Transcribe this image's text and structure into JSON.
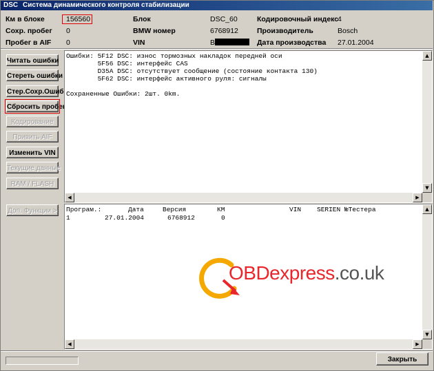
{
  "window": {
    "app": "DSC",
    "title": "Система динамического контроля стабилизации"
  },
  "info": {
    "km_label": "Км в блоке",
    "km_value": "156560",
    "sohr_label": "Сохр. пробег",
    "sohr_value": "0",
    "aif_label": "Пробег в AIF",
    "aif_value": "0",
    "block_label": "Блок",
    "block_value": "DSC_60",
    "bmw_label": "BMW номер",
    "bmw_value": "6768912",
    "vin_label": "VIN",
    "vin_value": "B",
    "code_label": "Кодировочный индекс",
    "code_value": "4",
    "maker_label": "Производитель",
    "maker_value": "Bosch",
    "date_label": "Дата производства",
    "date_value": "27.01.2004"
  },
  "buttons": {
    "read_errors": "Читать ошибки",
    "clear_errors": "Стереть ошибки",
    "clear_saved": "Стер.Сохр.Ошиб",
    "reset_mileage": "Сбросить пробег",
    "coding": "Кодирование",
    "write_aif": "Привить AIF",
    "change_vin": "Изменить VIN",
    "current_data": "Текущие данные",
    "ram_flash": "RAM / FLASH",
    "extra_functions": "Доп. Функции >",
    "close": "Закрыть"
  },
  "errors_panel": {
    "lines": [
      "Ошибки: 5F12 DSC: износ тормозных накладок передней оси",
      "        5F56 DSC: интерфейс CAS",
      "        D35A DSC: отсутствует сообщение (состояние контакта 130)",
      "        5F62 DSC: интерфейс активного руля: сигналы",
      "",
      "Сохраненные Ошибки: 2шт. 0km."
    ]
  },
  "program_table": {
    "headers": [
      "Програм.:",
      "Дата",
      "Версия",
      "КМ",
      "VIN",
      "SERIEN №Тестера"
    ],
    "rows": [
      [
        "1",
        "27.01.2004",
        "6768912",
        "0",
        "",
        ""
      ]
    ]
  },
  "watermark": {
    "brand": "OBDexpress",
    "suffix": ".co.uk",
    "brand_color": "#e8262b",
    "suffix_color": "#555555",
    "ring_color": "#f5a800"
  }
}
